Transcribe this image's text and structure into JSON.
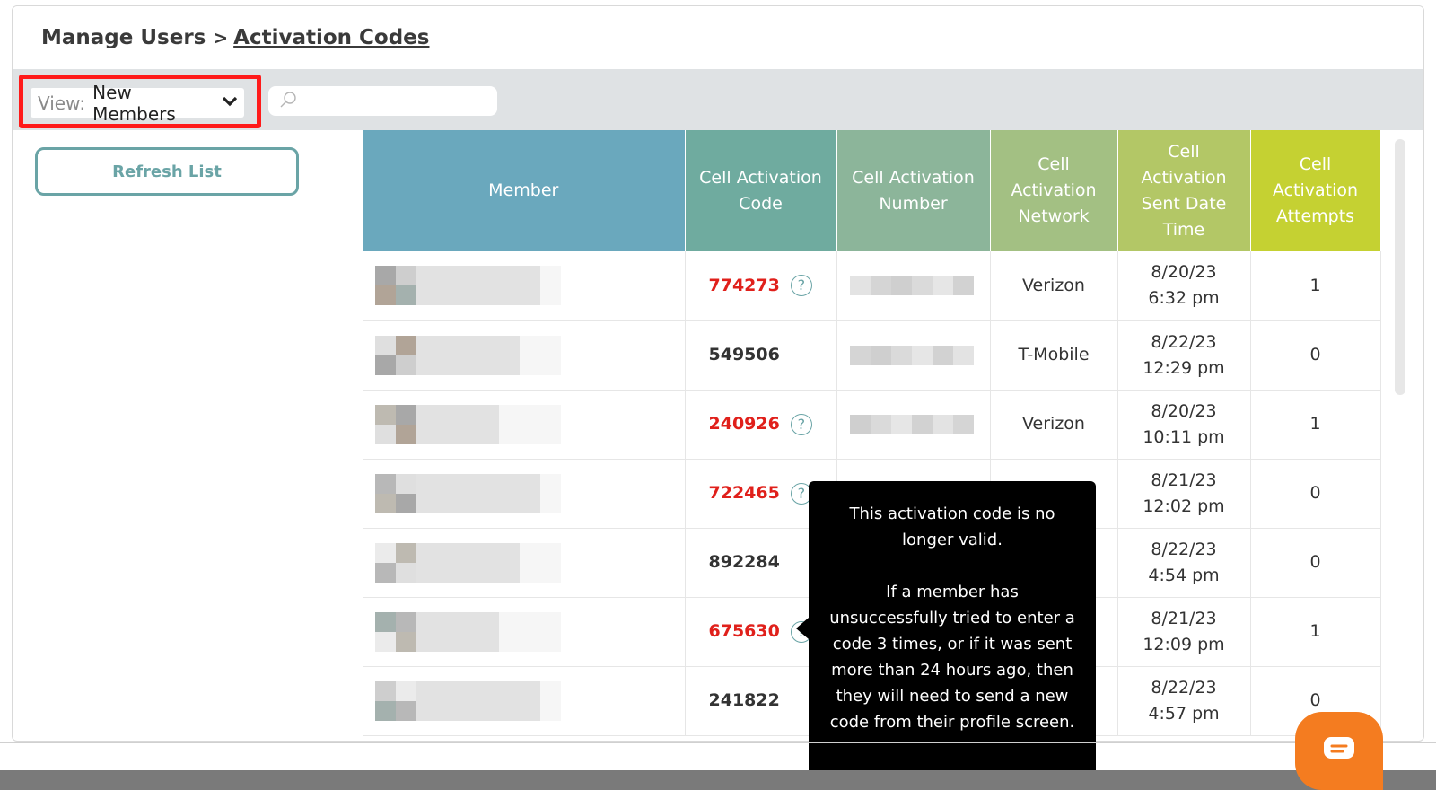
{
  "breadcrumb": {
    "parent": "Manage Users",
    "separator": ">",
    "current": "Activation Codes"
  },
  "toolbar": {
    "view_label": "View:",
    "view_value": "New Members",
    "search_placeholder": ""
  },
  "refresh_label": "Refresh List",
  "table": {
    "headers": {
      "member": "Member",
      "code": "Cell Activation Code",
      "number": "Cell Activation Number",
      "network": "Cell Activation Network",
      "sent": "Cell Activation Sent Date Time",
      "attempts": "Cell Activation Attempts"
    },
    "header_colors": [
      "#6aa8bd",
      "#6fab9f",
      "#8cb59a",
      "#a3c083",
      "#b3c766",
      "#c5d132"
    ],
    "rows": [
      {
        "code": "774273",
        "invalid": true,
        "network": "Verizon",
        "date": "8/20/23",
        "time": "6:32 pm",
        "attempts": "1"
      },
      {
        "code": "549506",
        "invalid": false,
        "network": "T-Mobile",
        "date": "8/22/23",
        "time": "12:29 pm",
        "attempts": "0"
      },
      {
        "code": "240926",
        "invalid": true,
        "network": "Verizon",
        "date": "8/20/23",
        "time": "10:11 pm",
        "attempts": "1"
      },
      {
        "code": "722465",
        "invalid": true,
        "network": "",
        "date": "8/21/23",
        "time": "12:02 pm",
        "attempts": "0"
      },
      {
        "code": "892284",
        "invalid": false,
        "network": "",
        "date": "8/22/23",
        "time": "4:54 pm",
        "attempts": "0"
      },
      {
        "code": "675630",
        "invalid": true,
        "network": "",
        "date": "8/21/23",
        "time": "12:09 pm",
        "attempts": "1"
      },
      {
        "code": "241822",
        "invalid": false,
        "network": "",
        "date": "8/22/23",
        "time": "4:57 pm",
        "attempts": "0"
      }
    ]
  },
  "tooltip": {
    "line1": "This activation code is no longer valid.",
    "line2": "If a member has unsuccessfully tried to enter a code 3 times, or if it was sent more than 24 hours ago, then they will need to send a new code from their profile screen."
  },
  "colors": {
    "accent": "#6aa4a6",
    "invalid_code": "#e0201b",
    "highlight_box": "#ff1a1a",
    "chat": "#f47c20"
  },
  "icons": {
    "view_dropdown": "chevron-down-icon",
    "search": "search-icon",
    "help": "question-circle-icon",
    "chat": "chat-bubble-icon"
  }
}
